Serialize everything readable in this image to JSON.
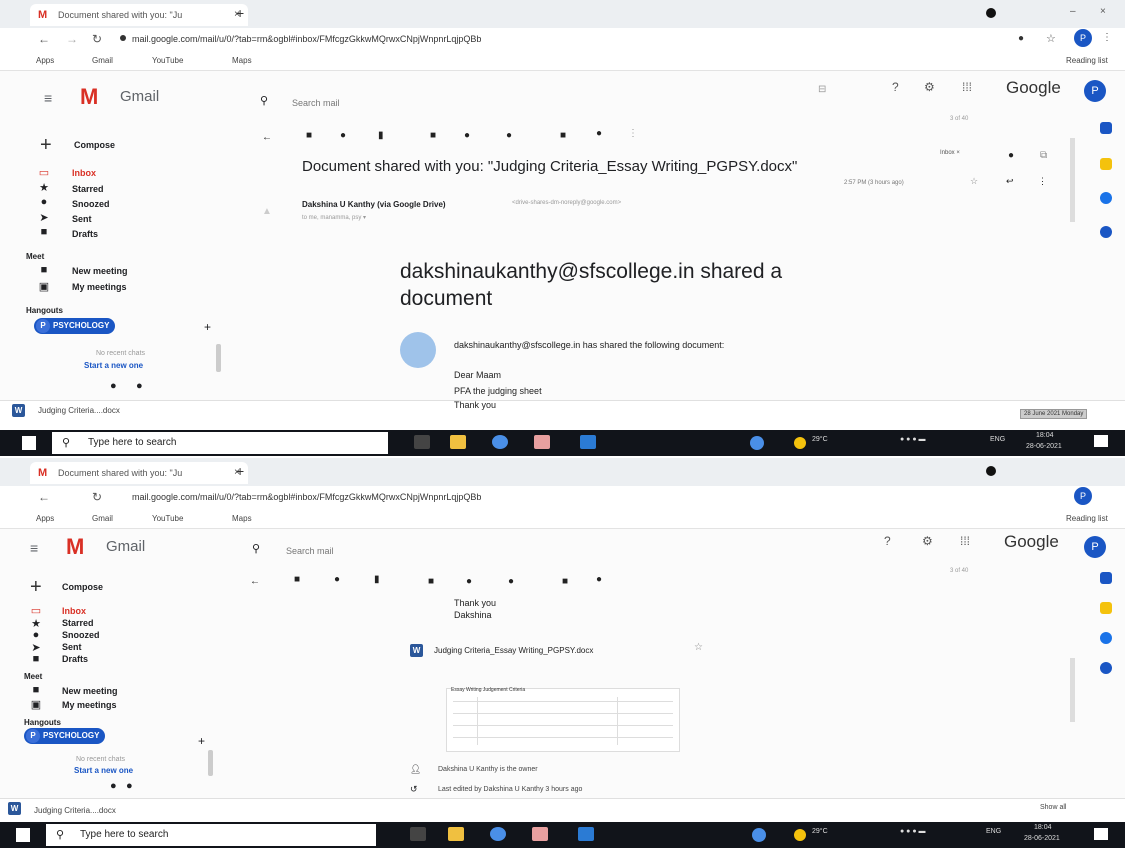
{
  "browser": {
    "tab_title": "Document shared with you: \"Ju",
    "tab_close": "×",
    "new_tab": "+",
    "url_1": "mail.google.com/mail/u/0/?tab=rm&ogbl#inbox/FMfcgzGkkwMQrwxCNpjWnpnrLqjpQBb",
    "url_2": "mail.google.com/mail/u/0/?tab=rm&ogbl#inbox/FMfcgzGkkwMQrwxCNpjWnpnrLqjpQBb",
    "bookmarks": [
      "Apps",
      "Gmail",
      "YouTube",
      "Maps"
    ],
    "reading_list": "Reading list",
    "profile_initial": "P"
  },
  "gmail": {
    "logo": "M",
    "name": "Gmail",
    "search_placeholder": "Search mail",
    "google": "Google",
    "compose": "Compose",
    "nav": [
      "Inbox",
      "Starred",
      "Snoozed",
      "Sent",
      "Drafts"
    ],
    "meet_heading": "Meet",
    "meet_items": [
      "New meeting",
      "My meetings"
    ],
    "hangouts_heading": "Hangouts",
    "hangouts_chip": "PSYCHOLOGY",
    "hangouts_add": "+",
    "no_recent": "No recent chats",
    "start_new": "Start a new one",
    "download_1": "Judging Criteria....docx",
    "download_2": "Judging Criteria....docx",
    "page_count": "3 of 40",
    "show_all": "Show all"
  },
  "email": {
    "subject": "Document shared with you: \"Judging Criteria_Essay Writing_PGPSY.docx\"",
    "label": "Inbox ×",
    "sender": "Dakshina U Kanthy (via Google Drive)",
    "sender_address": "<drive-shares-dm-noreply@google.com>",
    "to": "to me, manamma, psy ▾",
    "time": "2:57 PM (3 hours ago)",
    "headline": "dakshinaukanthy@sfscollege.in shared a document",
    "share_line": "dakshinaukanthy@sfscollege.in has shared the following document:",
    "body": [
      "Dear Maam",
      "PFA the judging sheet",
      "Thank you",
      "Dakshina"
    ],
    "attachment": "Judging Criteria_Essay Writing_PGPSY.docx",
    "thumb_title": "Essay Writing Judgement Criteria",
    "owner": "Dakshina U Kanthy is the owner",
    "edited": "Last edited by Dakshina U Kanthy 3 hours ago"
  },
  "taskbar": {
    "search": "Type here to search",
    "weather": "29°C",
    "lang": "ENG",
    "time": "18:04",
    "date": "28-06-2021",
    "tooltip": "28 June 2021 Monday"
  },
  "colors": {
    "gmail_red": "#d93025",
    "google_blue": "#1a56c4",
    "taskbar": "#11141a"
  }
}
